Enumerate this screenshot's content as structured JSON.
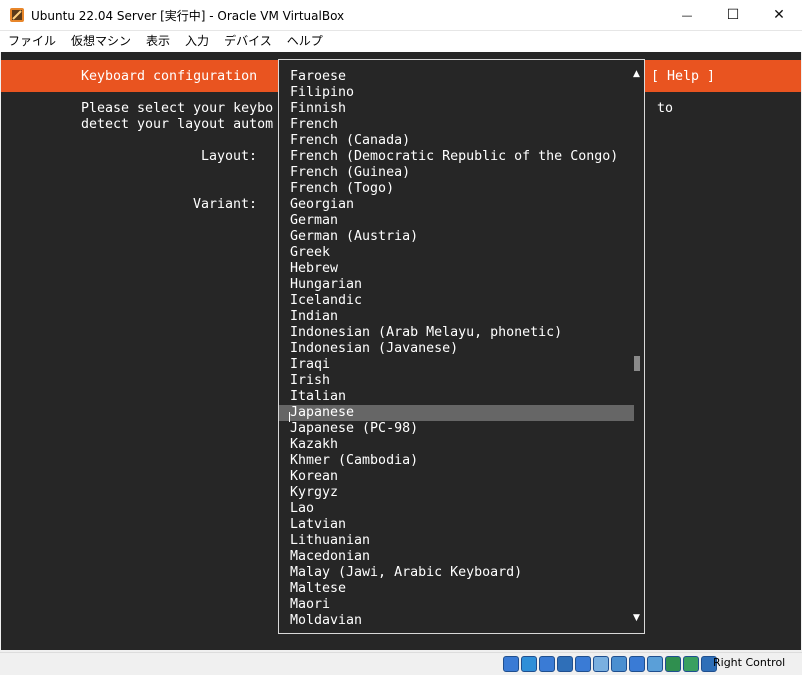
{
  "window": {
    "title": "Ubuntu 22.04 Server [実行中] - Oracle VM VirtualBox",
    "minimize_glyph": "—",
    "maximize_glyph": "☐",
    "close_glyph": "✕"
  },
  "menu": {
    "items": [
      {
        "label": "ファイル"
      },
      {
        "label": "仮想マシン"
      },
      {
        "label": "表示"
      },
      {
        "label": "入力"
      },
      {
        "label": "デバイス"
      },
      {
        "label": "ヘルプ"
      }
    ]
  },
  "installer": {
    "header_title": "Keyboard configuration",
    "help_label": "[ Help ]",
    "body_line1": "Please select your keybo",
    "body_line2": "detect your layout autom",
    "body_right": "to",
    "layout_label": "Layout:",
    "variant_label": "Variant:",
    "scroll_up": "▲",
    "scroll_down": "▼"
  },
  "dropdown": {
    "selected": "Japanese",
    "options": [
      "Faroese",
      "Filipino",
      "Finnish",
      "French",
      "French (Canada)",
      "French (Democratic Republic of the Congo)",
      "French (Guinea)",
      "French (Togo)",
      "Georgian",
      "German",
      "German (Austria)",
      "Greek",
      "Hebrew",
      "Hungarian",
      "Icelandic",
      "Indian",
      "Indonesian (Arab Melayu, phonetic)",
      "Indonesian (Javanese)",
      "Iraqi",
      "Irish",
      "Italian",
      "Japanese",
      "Japanese (PC-98)",
      "Kazakh",
      "Khmer (Cambodia)",
      "Korean",
      "Kyrgyz",
      "Lao",
      "Latvian",
      "Lithuanian",
      "Macedonian",
      "Malay (Jawi, Arabic Keyboard)",
      "Maltese",
      "Maori",
      "Moldavian"
    ]
  },
  "statusbar": {
    "host_key": "Right Control",
    "icons": [
      {
        "name": "hard-disk-icon",
        "color": "#3a7bd5"
      },
      {
        "name": "optical-drive-icon",
        "color": "#2f8fd8"
      },
      {
        "name": "audio-icon",
        "color": "#3a7bd5"
      },
      {
        "name": "network-icon",
        "color": "#2f6fb8"
      },
      {
        "name": "usb-icon",
        "color": "#3a7bd5"
      },
      {
        "name": "shared-folder-icon",
        "color": "#7ab0e0"
      },
      {
        "name": "display-icon",
        "color": "#4a8fd0"
      },
      {
        "name": "recording-icon",
        "color": "#3a7bd5"
      },
      {
        "name": "cpu-icon",
        "color": "#5a9fd8"
      },
      {
        "name": "virtualization-icon",
        "color": "#2f8f4f"
      },
      {
        "name": "mouse-integration-icon",
        "color": "#3aa060"
      },
      {
        "name": "keyboard-capture-icon",
        "color": "#2f6fb8"
      }
    ]
  },
  "colors": {
    "ubuntu_orange": "#e95420",
    "terminal_bg": "#262626",
    "selection_bg": "#666666"
  }
}
